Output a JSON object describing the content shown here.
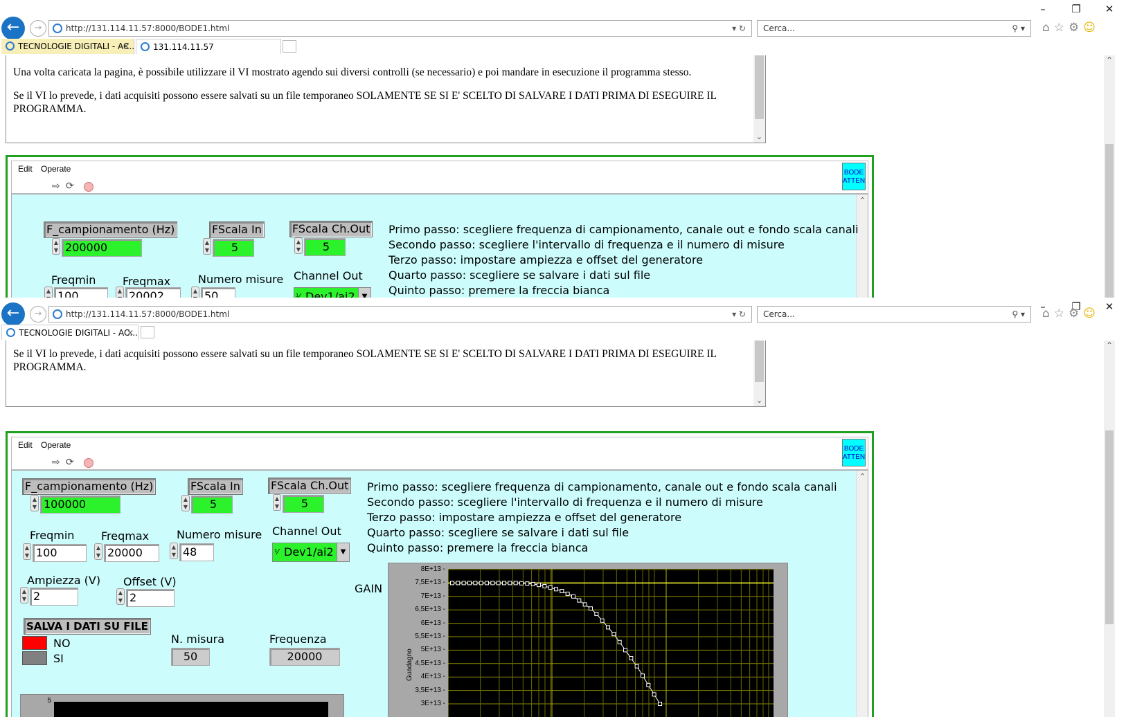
{
  "browser": {
    "url": "http://131.114.11.57:8000/BODE1.html",
    "search_placeholder": "Cerca...",
    "tabs_w1": [
      "TECNOLOGIE DIGITALI - AC...",
      "131.114.11.57"
    ],
    "tabs_w2": [
      "TECNOLOGIE DIGITALI - AC..."
    ]
  },
  "intro": {
    "p1": "Una volta caricata la pagina, è possibile utilizzare il VI mostrato agendo sui diversi controlli (se necessario) e poi mandare in esecuzione il programma stesso.",
    "p2": "Se il VI lo prevede, i dati acquisiti possono essere salvati su un file temporaneo SOLAMENTE SE SI E' SCELTO DI SALVARE I DATI PRIMA DI ESEGUIRE IL PROGRAMMA."
  },
  "vi_menu": {
    "edit": "Edit",
    "operate": "Operate",
    "icon_line1": "BODE",
    "icon_line2": "ATTEN"
  },
  "labels": {
    "fcamp": "F_campionamento (Hz)",
    "fscala_in": "FScala In",
    "fscala_out": "FScala Ch.Out",
    "freqmin": "Freqmin",
    "freqmax": "Freqmax",
    "nmisure": "Numero misure",
    "channel_out": "Channel Out",
    "ampiezza": "Ampiezza (V)",
    "offset": "Offset (V)",
    "salva": "SALVA I DATI SU FILE",
    "no": "NO",
    "si": "SI",
    "nmisura": "N. misura",
    "frequenza": "Frequenza",
    "gain": "GAIN",
    "guadagno": "Guadagno"
  },
  "steps": [
    "Primo passo: scegliere frequenza di campionamento, canale out e fondo scala canali",
    "Secondo passo: scegliere l'intervallo di frequenza e il numero di misure",
    "Terzo passo: impostare ampiezza e offset del generatore",
    "Quarto passo: scegliere se salvare i dati sul file",
    "Quinto passo: premere la freccia bianca"
  ],
  "w1": {
    "fcamp": "200000",
    "fscala_in": "5",
    "fscala_out": "5",
    "freqmin": "100",
    "freqmax": "20002",
    "nmisure": "50",
    "channel": "Dev1/ai2"
  },
  "w2": {
    "fcamp": "100000",
    "fscala_in": "5",
    "fscala_out": "5",
    "freqmin": "100",
    "freqmax": "20000",
    "nmisure": "48",
    "channel": "Dev1/ai2",
    "ampiezza": "2",
    "offset": "2",
    "nmisura": "50",
    "frequenza": "20000"
  },
  "colors": {
    "panel_bg": "#ccfcfc",
    "numeric_green": "#2bf22b",
    "led_red": "#ff0000",
    "frame_green": "#1fa01f"
  },
  "small_graph": {
    "y_tick": "5"
  },
  "chart_data": {
    "type": "line",
    "title": "GAIN",
    "ylabel": "Guadagno",
    "ytick_labels": [
      "8E+13",
      "7,5E+13",
      "7E+13",
      "6,5E+13",
      "6E+13",
      "5,5E+13",
      "5E+13",
      "4,5E+13",
      "4E+13",
      "3,5E+13",
      "3E+13"
    ],
    "ylim": [
      30000000000000.0,
      80000000000000.0
    ],
    "grid": true,
    "series": [
      {
        "values": [
          75000000000000.0,
          75000000000000.0,
          75000000000000.0,
          75000000000000.0,
          75000000000000.0,
          75000000000000.0,
          75000000000000.0,
          75000000000000.0,
          75000000000000.0,
          75000000000000.0,
          75000000000000.0,
          75000000000000.0,
          74900000000000.0,
          74800000000000.0,
          74600000000000.0,
          74300000000000.0,
          73800000000000.0,
          73300000000000.0,
          72700000000000.0,
          72000000000000.0,
          71000000000000.0,
          70000000000000.0,
          68500000000000.0,
          67000000000000.0,
          65500000000000.0,
          63500000000000.0,
          61000000000000.0,
          58500000000000.0,
          56000000000000.0,
          53000000000000.0,
          50000000000000.0,
          47000000000000.0,
          44000000000000.0,
          40500000000000.0,
          37000000000000.0,
          33500000000000.0,
          30000000000000.0
        ]
      }
    ]
  }
}
